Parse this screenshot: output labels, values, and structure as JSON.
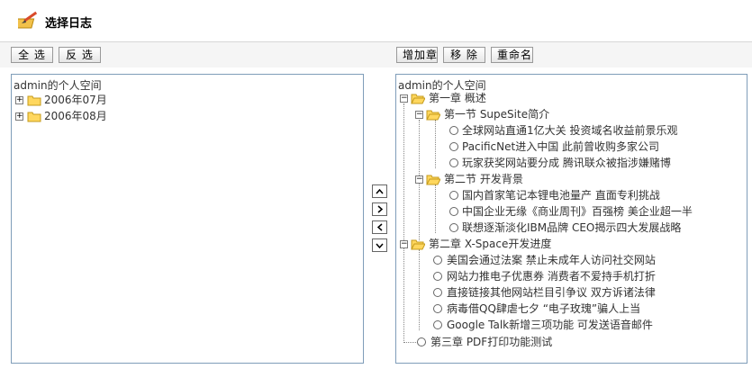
{
  "header": {
    "title": "选择日志",
    "logo_icon": "pencil-book-icon"
  },
  "toolbar": {
    "select_all": "全 选",
    "invert": "反 选",
    "add_chapter": "增加章",
    "remove": "移 除",
    "rename": "重命名"
  },
  "left_panel": {
    "root": "admin的个人空间",
    "items": [
      "2006年07月",
      "2006年08月"
    ]
  },
  "right_panel": {
    "root": "admin的个人空间",
    "ch1": "第一章  概述",
    "sec1": "第一节  SupeSite简介",
    "sec1_items": [
      "全球网站直通1亿大关  投资域名收益前景乐观",
      "PacificNet进入中国  此前曾收购多家公司",
      "玩家获奖网站要分成  腾讯联众被指涉嫌赌博"
    ],
    "sec2": "第二节  开发背景",
    "sec2_items": [
      "国内首家笔记本锂电池量产  直面专利挑战",
      "中国企业无缘《商业周刊》百强榜  美企业超一半",
      "联想逐渐淡化IBM品牌  CEO揭示四大发展战略"
    ],
    "ch2": "第二章  X-Space开发进度",
    "ch2_items": [
      "美国会通过法案  禁止未成年人访问社交网站",
      "网站力推电子优惠券  消费者不爱持手机打折",
      "直接链接其他网站栏目引争议  双方诉诸法律",
      "病毒借QQ肆虐七夕  “电子玫瑰”骗人上当",
      "Google Talk新增三项功能  可发送语音邮件"
    ],
    "ch3": "第三章  PDF打印功能测试"
  },
  "transfer_buttons": [
    "arrow-up-icon",
    "arrow-right-icon",
    "arrow-left-icon",
    "arrow-down-icon"
  ]
}
